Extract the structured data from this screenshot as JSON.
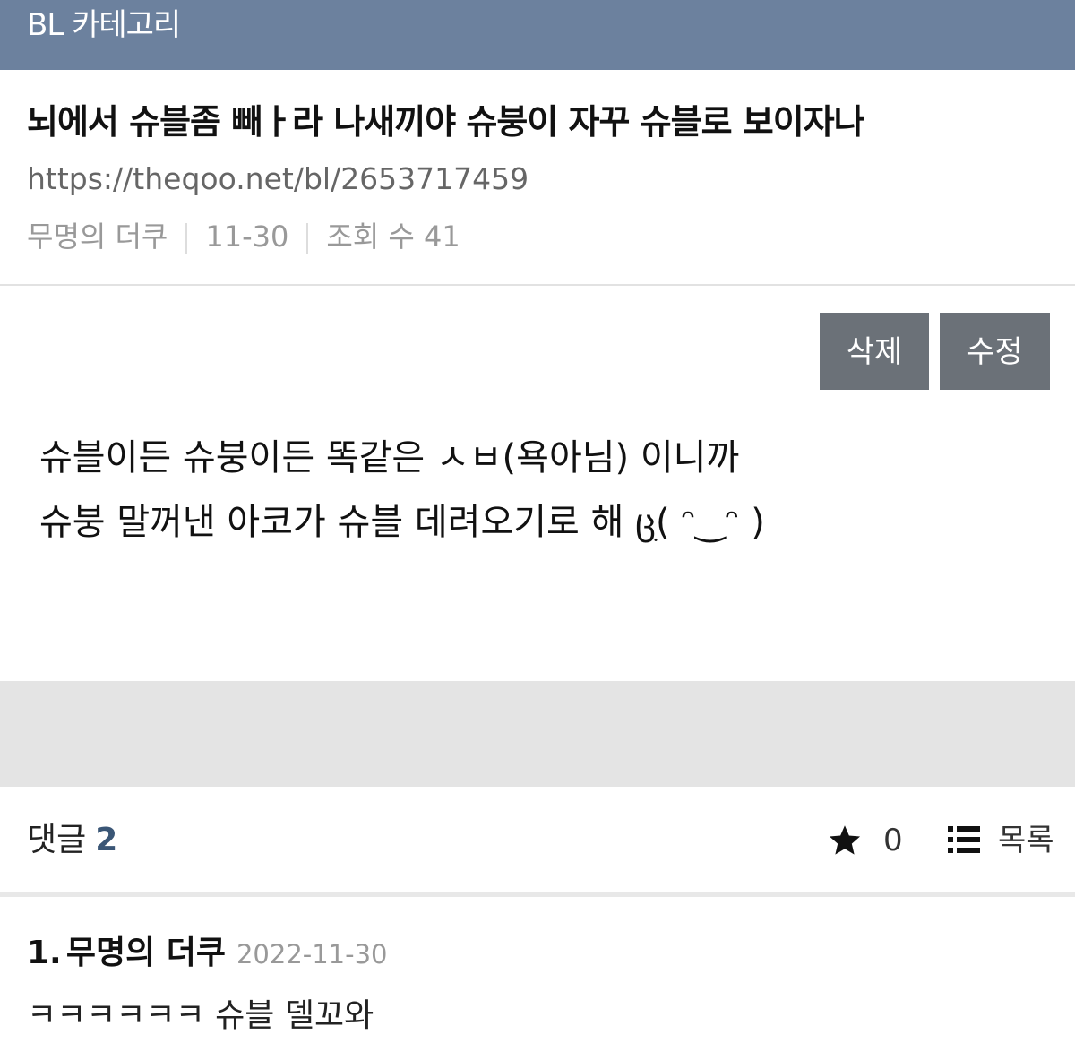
{
  "header": {
    "category": "BL 카테고리"
  },
  "post": {
    "title": "뇌에서 슈블좀 빼ㅏ라 나새끼야 슈붕이 자꾸 슈블로 보이자나",
    "url": "https://theqoo.net/bl/2653717459",
    "author": "무명의 더쿠",
    "date": "11-30",
    "views_label": "조회 수 41",
    "delete_label": "삭제",
    "edit_label": "수정",
    "body_lines": [
      "슈블이든 슈붕이든 똑같은 ㅅㅂ(욕아님) 이니까",
      "슈붕 말꺼낸 아코가 슈블 데려오기로 해 ცׅ( ᵔ‿ᵔ )"
    ]
  },
  "comment_bar": {
    "label": "댓글",
    "count": "2",
    "star_count": "0",
    "list_label": "목록",
    "icons": [
      "star-icon",
      "list-icon"
    ]
  },
  "comments": [
    {
      "number": "1.",
      "author": "무명의 더쿠",
      "date": "2022-11-30",
      "text": "ㅋㅋㅋㅋㅋㅋ 슈블 델꼬와"
    }
  ],
  "colors": {
    "header_bg": "#6c819e",
    "button_bg": "#6b7178",
    "count_color": "#3a5676",
    "band_gray": "#e4e4e4"
  }
}
